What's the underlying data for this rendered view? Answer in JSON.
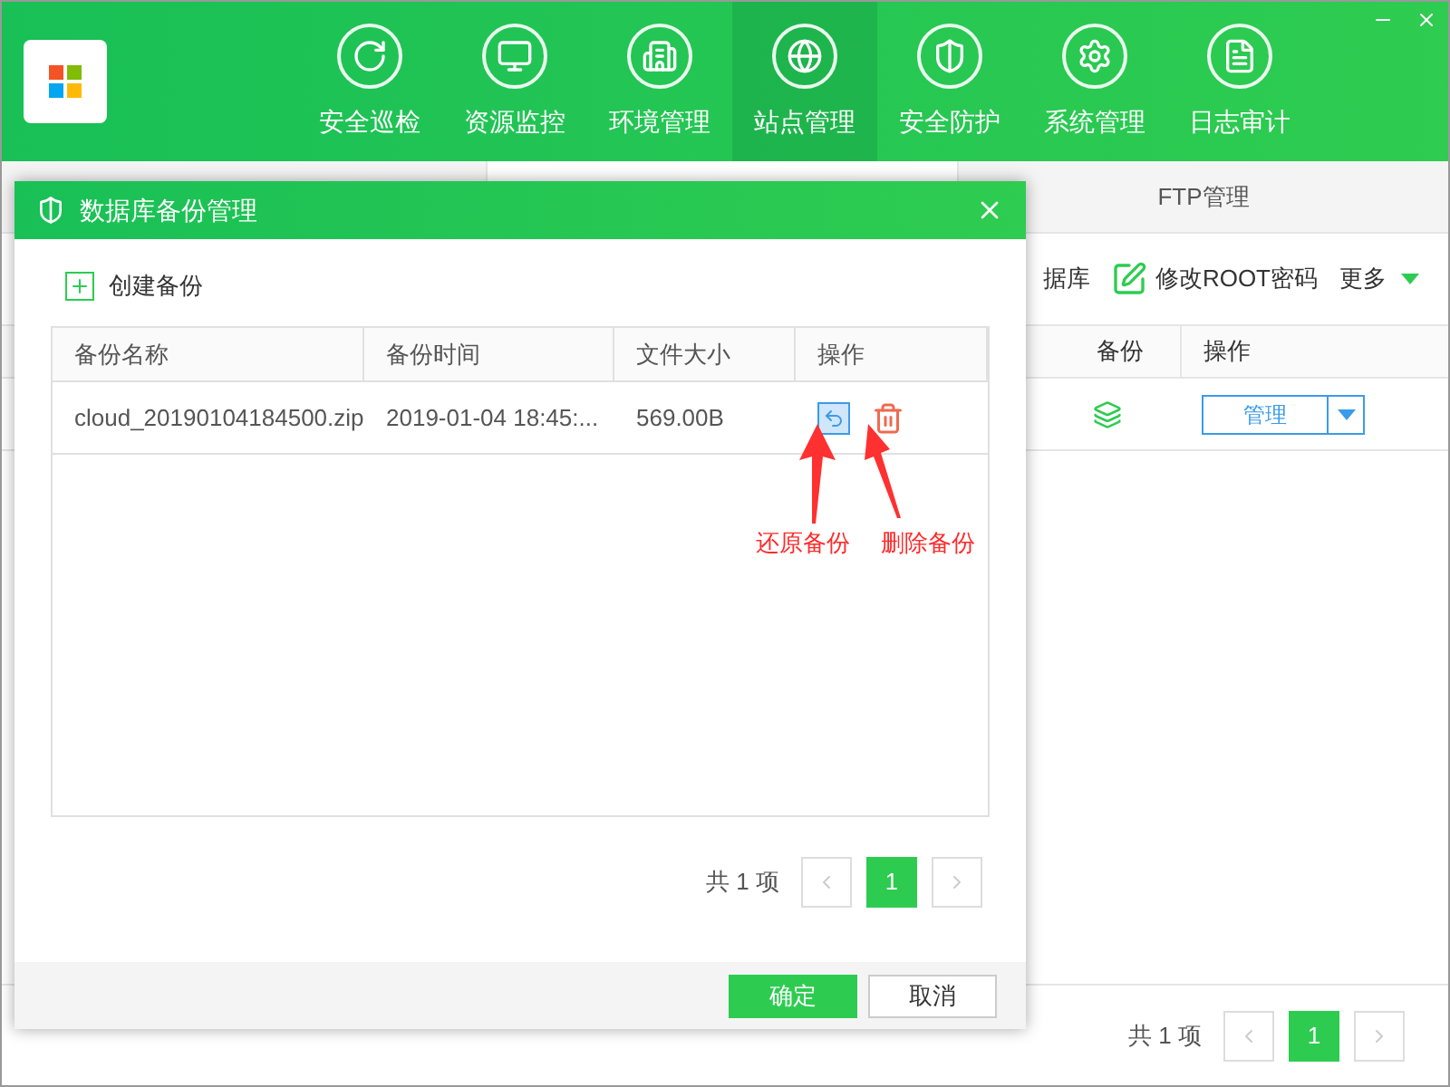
{
  "nav": [
    {
      "label": "安全巡检",
      "selected": false,
      "kind": "inspect"
    },
    {
      "label": "资源监控",
      "selected": false,
      "kind": "monitor"
    },
    {
      "label": "环境管理",
      "selected": false,
      "kind": "building"
    },
    {
      "label": "站点管理",
      "selected": true,
      "kind": "globe"
    },
    {
      "label": "安全防护",
      "selected": false,
      "kind": "shield"
    },
    {
      "label": "系统管理",
      "selected": false,
      "kind": "settings"
    },
    {
      "label": "日志审计",
      "selected": false,
      "kind": "log"
    }
  ],
  "background": {
    "tabs": [
      {
        "label": "FTP管理",
        "selected": false
      }
    ],
    "toolbar": {
      "partial_button": "据库",
      "edit_root_password": "修改ROOT密码",
      "more": "更多"
    },
    "table": {
      "columns": [
        "备份",
        "操作"
      ],
      "rows": [
        {
          "manage_button": "管理"
        }
      ]
    },
    "pagination": {
      "total": "共 1 项",
      "pages": [
        {
          "label": "1",
          "selected": true
        }
      ]
    }
  },
  "modal": {
    "title": "数据库备份管理",
    "create_button": "创建备份",
    "table": {
      "columns": [
        "备份名称",
        "备份时间",
        "文件大小",
        "操作"
      ],
      "rows": [
        {
          "name": "cloud_20190104184500.zip",
          "time": "2019-01-04 18:45:...",
          "size": "569.00B"
        }
      ]
    },
    "pagination": {
      "total": "共 1 项",
      "pages": [
        {
          "label": "1",
          "selected": true
        }
      ]
    },
    "buttons": [
      {
        "label": "确定",
        "kind": "primary"
      },
      {
        "label": "取消",
        "kind": "secondary"
      }
    ]
  },
  "annotations": [
    {
      "label": "还原备份"
    },
    {
      "label": "删除备份"
    }
  ]
}
